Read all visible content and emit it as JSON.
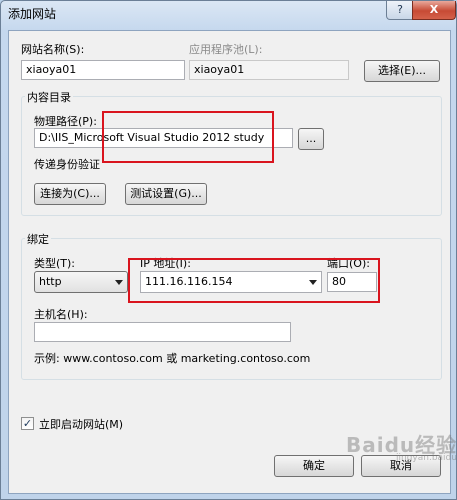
{
  "window": {
    "title": "添加网站",
    "help_glyph": "?",
    "close_glyph": "X"
  },
  "site": {
    "name_label": "网站名称(S):",
    "name_value": "xiaoya01",
    "pool_label": "应用程序池(L):",
    "pool_value": "xiaoya01",
    "select_button": "选择(E)..."
  },
  "content": {
    "group_title": "内容目录",
    "path_label": "物理路径(P):",
    "path_value": "D:\\IIS_Microsoft Visual Studio 2012 study",
    "browse_button": "...",
    "auth_label": "传递身份验证",
    "connect_button": "连接为(C)...",
    "test_button": "测试设置(G)..."
  },
  "binding": {
    "group_title": "绑定",
    "type_label": "类型(T):",
    "type_value": "http",
    "ip_label": "IP 地址(I):",
    "ip_value": "111.16.116.154",
    "port_label": "端口(O):",
    "port_value": "80",
    "host_label": "主机名(H):",
    "host_value": "",
    "example_text": "示例: www.contoso.com 或 marketing.contoso.com"
  },
  "start": {
    "checkbox_label": "立即启动网站(M)",
    "checked": true,
    "check_glyph": "✓"
  },
  "footer": {
    "ok_button": "确定",
    "cancel_button": "取消"
  },
  "watermark": {
    "text": "Baidu经验",
    "sub": "jingyan.baidu.com"
  },
  "colors": {
    "highlight_box": "#d9141e",
    "dialog_bg": "#f0f0f0",
    "frame": "#b9d1ea"
  }
}
